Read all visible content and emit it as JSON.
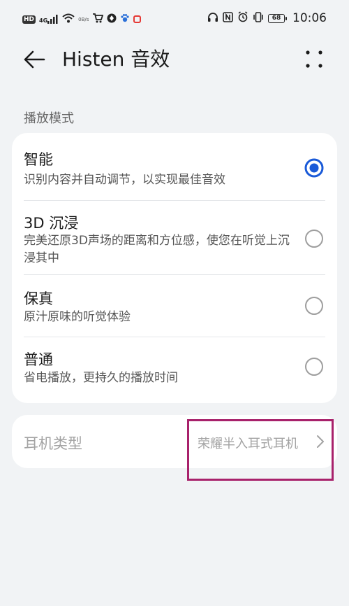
{
  "status_bar": {
    "left_icons": [
      "hd-badge",
      "signal-4g-icon",
      "wifi-icon",
      "speed-text",
      "cart-icon",
      "shield-app-icon",
      "paw-app-icon",
      "red-app-icon"
    ],
    "hd_label": "HD",
    "network_label": "4G",
    "speed_label": "0B/s",
    "battery_level": "68",
    "time": "10:06",
    "right_icons": [
      "headphones-icon",
      "nfc-icon",
      "alarm-icon",
      "vibrate-icon",
      "battery-icon"
    ]
  },
  "header": {
    "title": "Histen 音效"
  },
  "playback_mode": {
    "section_label": "播放模式",
    "selected_index": 0,
    "options": [
      {
        "title": "智能",
        "description": "识别内容并自动调节，以实现最佳音效"
      },
      {
        "title": "3D 沉浸",
        "description": "完美还原3D声场的距离和方位感，使您在听觉上沉浸其中"
      },
      {
        "title": "保真",
        "description": "原汁原味的听觉体验"
      },
      {
        "title": "普通",
        "description": "省电播放，更持久的播放时间"
      }
    ]
  },
  "headphone_type": {
    "label": "耳机类型",
    "value": "荣耀半入耳式耳机"
  },
  "colors": {
    "accent": "#1a5ad8",
    "background": "#f1f3f5",
    "card": "#ffffff",
    "highlight_box": "#a8216b",
    "muted_text": "#a3a3a3"
  }
}
